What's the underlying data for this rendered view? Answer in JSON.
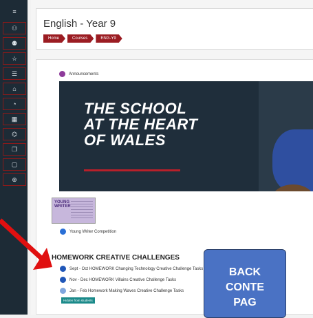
{
  "sidebar": {
    "items": [
      {
        "icon": "menu-icon",
        "glyph": "≡"
      },
      {
        "icon": "users-icon",
        "glyph": "⚇"
      },
      {
        "icon": "people-icon",
        "glyph": "⚉"
      },
      {
        "icon": "star-icon",
        "glyph": "☆"
      },
      {
        "icon": "list-icon",
        "glyph": "☰"
      },
      {
        "icon": "home-icon",
        "glyph": "⌂"
      },
      {
        "icon": "dashboard-icon",
        "glyph": "◔"
      },
      {
        "icon": "calendar-icon",
        "glyph": "▦"
      },
      {
        "icon": "graduation-icon",
        "glyph": "⌬"
      },
      {
        "icon": "files-icon",
        "glyph": "❐"
      },
      {
        "icon": "clipboard-icon",
        "glyph": "▢"
      },
      {
        "icon": "globe-icon",
        "glyph": "⊕"
      }
    ]
  },
  "header": {
    "title": "English - Year 9",
    "breadcrumbs": [
      "Home",
      "Courses",
      "ENG-Y9"
    ]
  },
  "content": {
    "announcements": "Announcements",
    "banner_text": [
      "THE SCHOOL",
      "AT THE HEART",
      "OF WALES"
    ],
    "thumb_title": "YOUNG WRITER",
    "young_writer_link": "Young Writer Competition",
    "section_title": "HOMEWORK CREATIVE CHALLENGES",
    "tasks": [
      "Sept - Oct HOMEWORK Changing Technology Creative Challenge Tasks",
      "Nov - Dec HOMEWORK Villains Creative Challenge Tasks",
      "Jan - Feb Homework Making Waves Creative Challenge Tasks"
    ],
    "hidden_badge": "Hidden from students"
  },
  "overlay": {
    "box_lines": [
      "BACK",
      "CONTE",
      "PAG"
    ]
  },
  "colors": {
    "sidebar_bg": "#1d2b36",
    "accent_red": "#9b1c22",
    "banner_bg": "#1f2e3b",
    "overlay_blue": "#4a72c4",
    "arrow_red": "#e01010"
  }
}
